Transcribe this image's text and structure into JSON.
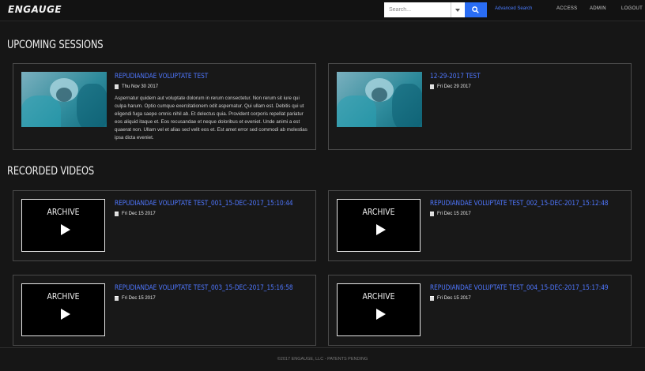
{
  "header": {
    "logo": "ENGAUGE",
    "search_placeholder": "Search...",
    "advanced_search": "Advanced Search",
    "nav": [
      "ACCESS",
      "ADMIN",
      "LOGOUT"
    ]
  },
  "upcoming": {
    "title": "UPCOMING SESSIONS",
    "sessions": [
      {
        "title": "REPUDIANDAE VOLUPTATE TEST",
        "date": "Thu Nov 30 2017",
        "description": "Aspernatur quidem aut voluptate dolorum in rerum consectetur. Non rerum sit iure qui culpa harum. Optio cumque exercitationem odit aspernatur. Qui ullam est. Debitis qui ut eligendi fuga saepe omnis nihil ab. Et delectus quia. Provident corporis repellat pariatur eos aliquid itaque et. Eos recusandae et neque doloribus et eveniet. Unde animi a est quaerat non. Ullam vel et alias sed velit eos et. Est amet error sed commodi ab molestias ipsa dicta eveniet."
      },
      {
        "title": "12-29-2017 TEST",
        "date": "Fri Dec 29 2017",
        "description": ""
      }
    ]
  },
  "recorded": {
    "title": "RECORDED VIDEOS",
    "archive_label": "ARCHIVE",
    "videos": [
      {
        "title": "REPUDIANDAE VOLUPTATE TEST_001_15-DEC-2017_15:10:44",
        "date": "Fri Dec 15 2017"
      },
      {
        "title": "REPUDIANDAE VOLUPTATE TEST_002_15-DEC-2017_15:12:48",
        "date": "Fri Dec 15 2017"
      },
      {
        "title": "REPUDIANDAE VOLUPTATE TEST_003_15-DEC-2017_15:16:58",
        "date": "Fri Dec 15 2017"
      },
      {
        "title": "REPUDIANDAE VOLUPTATE TEST_004_15-DEC-2017_15:17:49",
        "date": "Fri Dec 15 2017"
      }
    ]
  },
  "footer": "©2017 ENGAUGE, LLC - PATENTS PENDING",
  "colors": {
    "accent": "#2a6df4",
    "link": "#4f77ff",
    "background": "#161616"
  }
}
